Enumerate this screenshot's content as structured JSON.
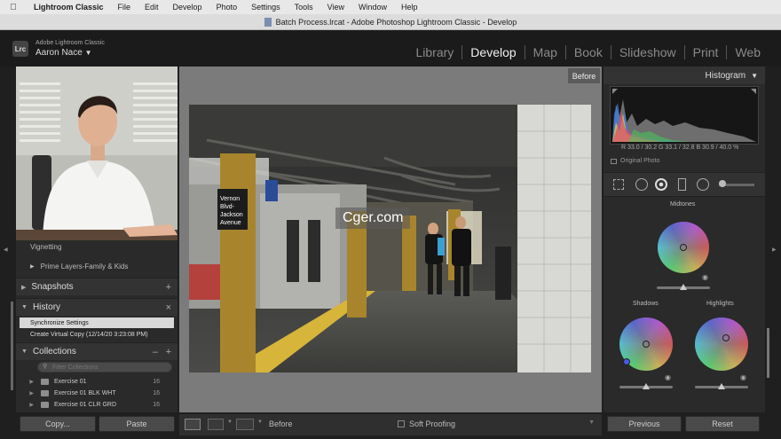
{
  "menubar": {
    "app": "Lightroom Classic",
    "items": [
      "File",
      "Edit",
      "Develop",
      "Photo",
      "Settings",
      "Tools",
      "View",
      "Window",
      "Help"
    ]
  },
  "window": {
    "title": "Batch Process.lrcat - Adobe Photoshop Lightroom Classic - Develop"
  },
  "identity": {
    "badge": "Lrc",
    "brand": "Adobe Lightroom Classic",
    "user": "Aaron Nace"
  },
  "modules": [
    "Library",
    "Develop",
    "Map",
    "Book",
    "Slideshow",
    "Print",
    "Web"
  ],
  "active_module": "Develop",
  "left_panel": {
    "vignetting_label": "Vignetting",
    "preset_label": "Prime Layers-Family & Kids",
    "snapshots_header": "Snapshots",
    "history_header": "History",
    "history_items": [
      "Synchronize Settings",
      "Create Virtual Copy (12/14/20 3:23:08 PM)"
    ],
    "collections_header": "Collections",
    "collections_filter_placeholder": "Filter Collections",
    "collections": [
      {
        "name": "Exercise 01",
        "count": "16"
      },
      {
        "name": "Exercise 01 BLK WHT",
        "count": "16"
      },
      {
        "name": "Exercise 01 CLR GRD",
        "count": "16"
      }
    ],
    "copy_label": "Copy...",
    "paste_label": "Paste"
  },
  "center": {
    "before_tag": "Before",
    "photo_sign": [
      "Vernon",
      "Blvd-",
      "Jackson",
      "Avenue"
    ],
    "toolbar_before": "Before",
    "soft_proofing": "Soft Proofing"
  },
  "watermark": "Cger.com",
  "right_panel": {
    "histogram_header": "Histogram",
    "rgb_readout": "R  33.0 / 30.2   G  33.1 / 32.8   B  30.9 / 40.0  %",
    "original_photo_label": "Original Photo",
    "midtones_label": "Midtones",
    "shadows_label": "Shadows",
    "highlights_label": "Highlights",
    "previous_label": "Previous",
    "reset_label": "Reset"
  },
  "colors": {
    "panel": "#2a2a2a",
    "accent_active": "#f0f0f0",
    "menubar": "#e8e8e8"
  }
}
